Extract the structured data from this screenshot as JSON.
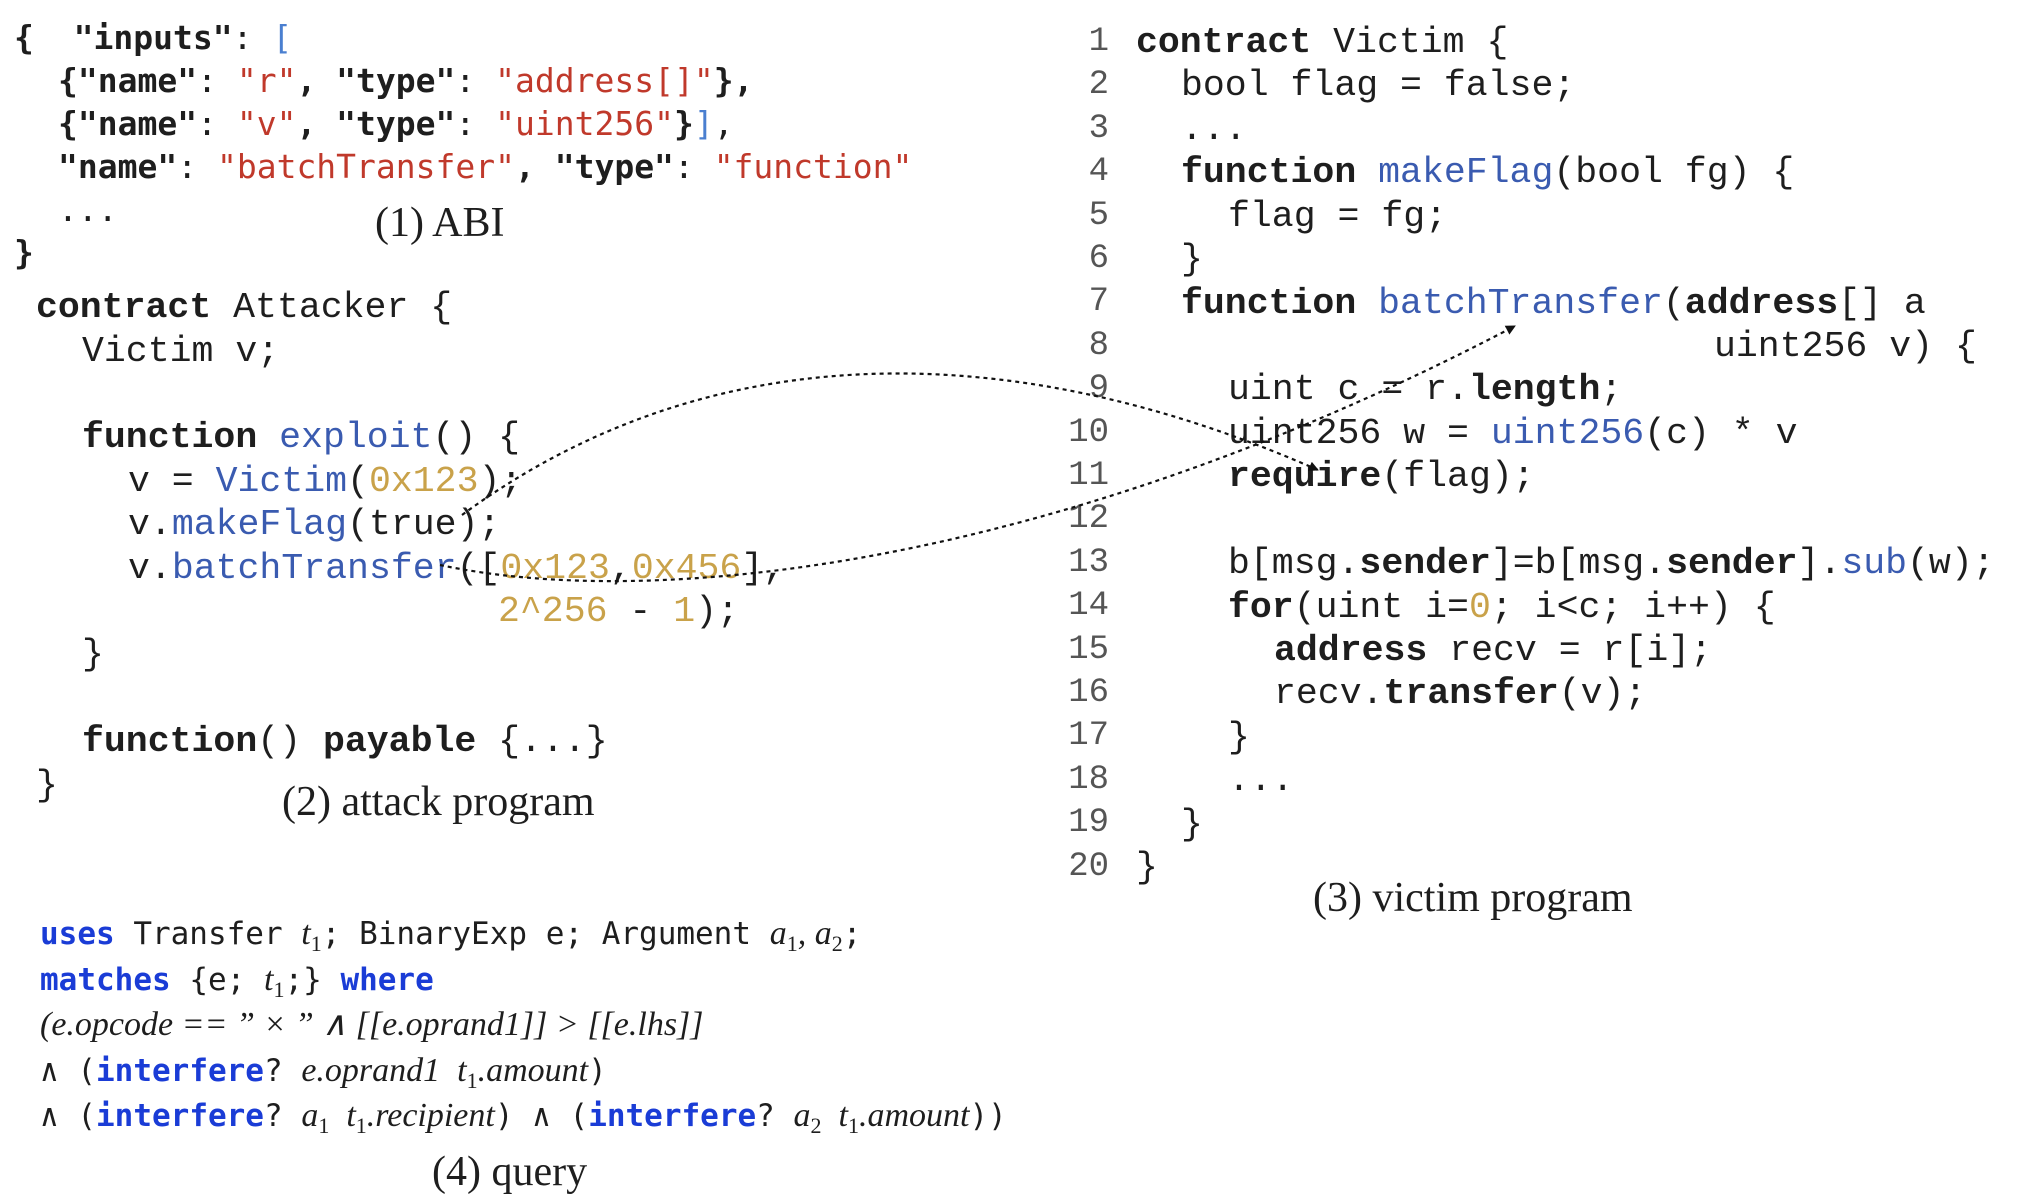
{
  "abi": {
    "l1_brace": "{",
    "l1_key": "\"inputs\"",
    "l1_colon": ": ",
    "l1_open": "[",
    "l2_a": "{\"name\"",
    "l2_b": ": ",
    "l2_c": "\"r\"",
    "l2_d": ", \"type\"",
    "l2_e": ": ",
    "l2_f": "\"address[]\"",
    "l2_g": "},",
    "l3_a": "{\"name\"",
    "l3_b": ": ",
    "l3_c": "\"v\"",
    "l3_d": ", \"type\"",
    "l3_e": ": ",
    "l3_f": "\"uint256\"",
    "l3_g": "}",
    "l3_h": "]",
    "l3_i": ",",
    "l4_a": "\"name\"",
    "l4_b": ": ",
    "l4_c": "\"batchTransfer\"",
    "l4_d": ", \"type\"",
    "l4_e": ": ",
    "l4_f": "\"function\"",
    "l5": "...",
    "l6": "}",
    "caption": "(1) ABI"
  },
  "attack": {
    "l1_kw": "contract",
    "l1_rest": " Attacker {",
    "l2": "Victim v;",
    "l4_kw": "function",
    "l4_fn": "exploit",
    "l4_rest": "() {",
    "l5_a": "v = ",
    "l5_fn": "Victim",
    "l5_b": "(",
    "l5_num": "0x123",
    "l5_c": ");",
    "l6_a": "v.",
    "l6_fn": "makeFlag",
    "l6_b": "(true);",
    "l7_a": "v.",
    "l7_fn": "batchTransfer",
    "l7_b": "([",
    "l7_n1": "0x123",
    "l7_c": ",",
    "l7_n2": "0x456",
    "l7_d": "],",
    "l8_n1": "2^256",
    "l8_a": " - ",
    "l8_n2": "1",
    "l8_b": ");",
    "l9": "}",
    "l11_kw1": "function",
    "l11_a": "() ",
    "l11_kw2": "payable",
    "l11_b": " {...}",
    "l12": "}",
    "caption": "(2) attack program"
  },
  "victim": {
    "line_numbers": [
      "1",
      "2",
      "3",
      "4",
      "5",
      "6",
      "7",
      "8",
      "9",
      "10",
      "11",
      "12",
      "13",
      "14",
      "15",
      "16",
      "17",
      "18",
      "19",
      "20"
    ],
    "l1_kw": "contract",
    "l1_rest": " Victim {",
    "l2": "bool flag = false;",
    "l3": "...",
    "l4_kw": "function",
    "l4_sp": " ",
    "l4_fn": "makeFlag",
    "l4_rest": "(bool fg) {",
    "l5": "flag = fg;",
    "l6": "}",
    "l7_kw": "function",
    "l7_sp": " ",
    "l7_fn": "batchTransfer",
    "l7_a": "(",
    "l7_kw2": "address",
    "l7_b": "[] a",
    "l8": "uint256 v) {",
    "l9_a": "uint c = r.",
    "l9_kw": "length",
    "l9_b": ";",
    "l10_a": "uint256 w = ",
    "l10_fn": "uint256",
    "l10_b": "(c) * v",
    "l11_kw": "require",
    "l11_b": "(flag);",
    "l13_a": "b[msg.",
    "l13_kw1": "sender",
    "l13_b": "]=b[msg.",
    "l13_kw2": "sender",
    "l13_c": "].",
    "l13_fn": "sub",
    "l13_d": "(w);",
    "l14_kw": "for",
    "l14_a": "(uint i=",
    "l14_num": "0",
    "l14_b": "; i<c; i++) {",
    "l15_kw": "address",
    "l15_a": " recv = r[i];",
    "l16_a": "recv.",
    "l16_kw": "transfer",
    "l16_b": "(v);",
    "l17": "}",
    "l18": "...",
    "l19": "}",
    "l20": "}",
    "caption": "(3) victim program"
  },
  "query": {
    "l1_kw": "uses",
    "l1_a": " Transfer ",
    "l1_t": "t",
    "l1_t_sub": "1",
    "l1_b": "; BinaryExp e; Argument ",
    "l1_args": "a",
    "l1_a1_sub": "1",
    "l1_c": ", a",
    "l1_a2_sub": "2",
    "l1_d": ";",
    "l2_kw1": "matches",
    "l2_a": " {e; ",
    "l2_t": "t",
    "l2_t_sub": "1",
    "l2_b": ";} ",
    "l2_kw2": "where",
    "l3": "(e.opcode == ” × ” ∧ [[e.oprand1]] > [[e.lhs]]",
    "l4_a": "∧ (",
    "l4_kw": "interfere",
    "l4_b": "? ",
    "l4_c": "e.oprand1  t",
    "l4_sub": "1",
    "l4_d": ".amount",
    "l4_e": ")",
    "l5_a": "∧ (",
    "l5_kw1": "interfere",
    "l5_b": "? ",
    "l5_c": "a",
    "l5_s1": "1",
    "l5_d": "  t",
    "l5_s2": "1",
    "l5_e": ".recipient",
    "l5_f": ") ∧ (",
    "l5_kw2": "interfere",
    "l5_g": "? ",
    "l5_h": "a",
    "l5_s3": "2",
    "l5_i": "  t",
    "l5_s4": "1",
    "l5_j": ".amount",
    "l5_k": "))",
    "caption": "(4) query"
  }
}
